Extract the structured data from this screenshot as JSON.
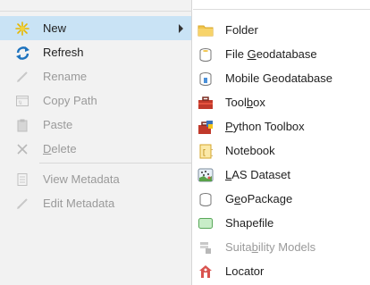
{
  "context_menu": {
    "items": [
      {
        "label": "New",
        "icon": "new-sparkle-icon",
        "highlighted": true,
        "submenu": true
      },
      {
        "label": "Refresh",
        "icon": "refresh-icon"
      },
      {
        "label": "Rename",
        "icon": "pencil-icon",
        "disabled": true
      },
      {
        "label": "Copy Path",
        "icon": "copy-path-icon",
        "disabled": true
      },
      {
        "label": "Paste",
        "icon": "paste-icon",
        "disabled": true
      },
      {
        "label_pre": "",
        "label_u": "D",
        "label_post": "elete",
        "icon": "delete-x-icon",
        "disabled": true
      },
      {
        "label": "View Metadata",
        "icon": "view-metadata-icon",
        "disabled": true
      },
      {
        "label": "Edit Metadata",
        "icon": "edit-metadata-icon",
        "disabled": true
      }
    ]
  },
  "submenu": {
    "items": [
      {
        "pre": "Folder",
        "u": "",
        "post": "",
        "icon": "folder-icon"
      },
      {
        "pre": "File ",
        "u": "G",
        "post": "eodatabase",
        "icon": "file-geodatabase-icon"
      },
      {
        "pre": "Mobile Geodatabase",
        "u": "",
        "post": "",
        "icon": "mobile-geodatabase-icon"
      },
      {
        "pre": "Tool",
        "u": "b",
        "post": "ox",
        "icon": "toolbox-icon"
      },
      {
        "pre": "",
        "u": "P",
        "post": "ython Toolbox",
        "icon": "python-toolbox-icon"
      },
      {
        "pre": "Notebook",
        "u": "",
        "post": "",
        "icon": "notebook-icon"
      },
      {
        "pre": "",
        "u": "L",
        "post": "AS Dataset",
        "icon": "las-dataset-icon"
      },
      {
        "pre": "G",
        "u": "e",
        "post": "oPackage",
        "icon": "geopackage-icon"
      },
      {
        "pre": "Shapefile",
        "u": "",
        "post": "",
        "icon": "shapefile-icon"
      },
      {
        "pre": "Suita",
        "u": "b",
        "post": "ility Models",
        "icon": "suitability-models-icon",
        "disabled": true
      },
      {
        "pre": "Locator",
        "u": "",
        "post": "",
        "icon": "locator-icon"
      }
    ]
  },
  "colors": {
    "highlight": "#c9e3f5",
    "disabled_text": "#9a9a9a",
    "accent_blue": "#1e73be"
  }
}
